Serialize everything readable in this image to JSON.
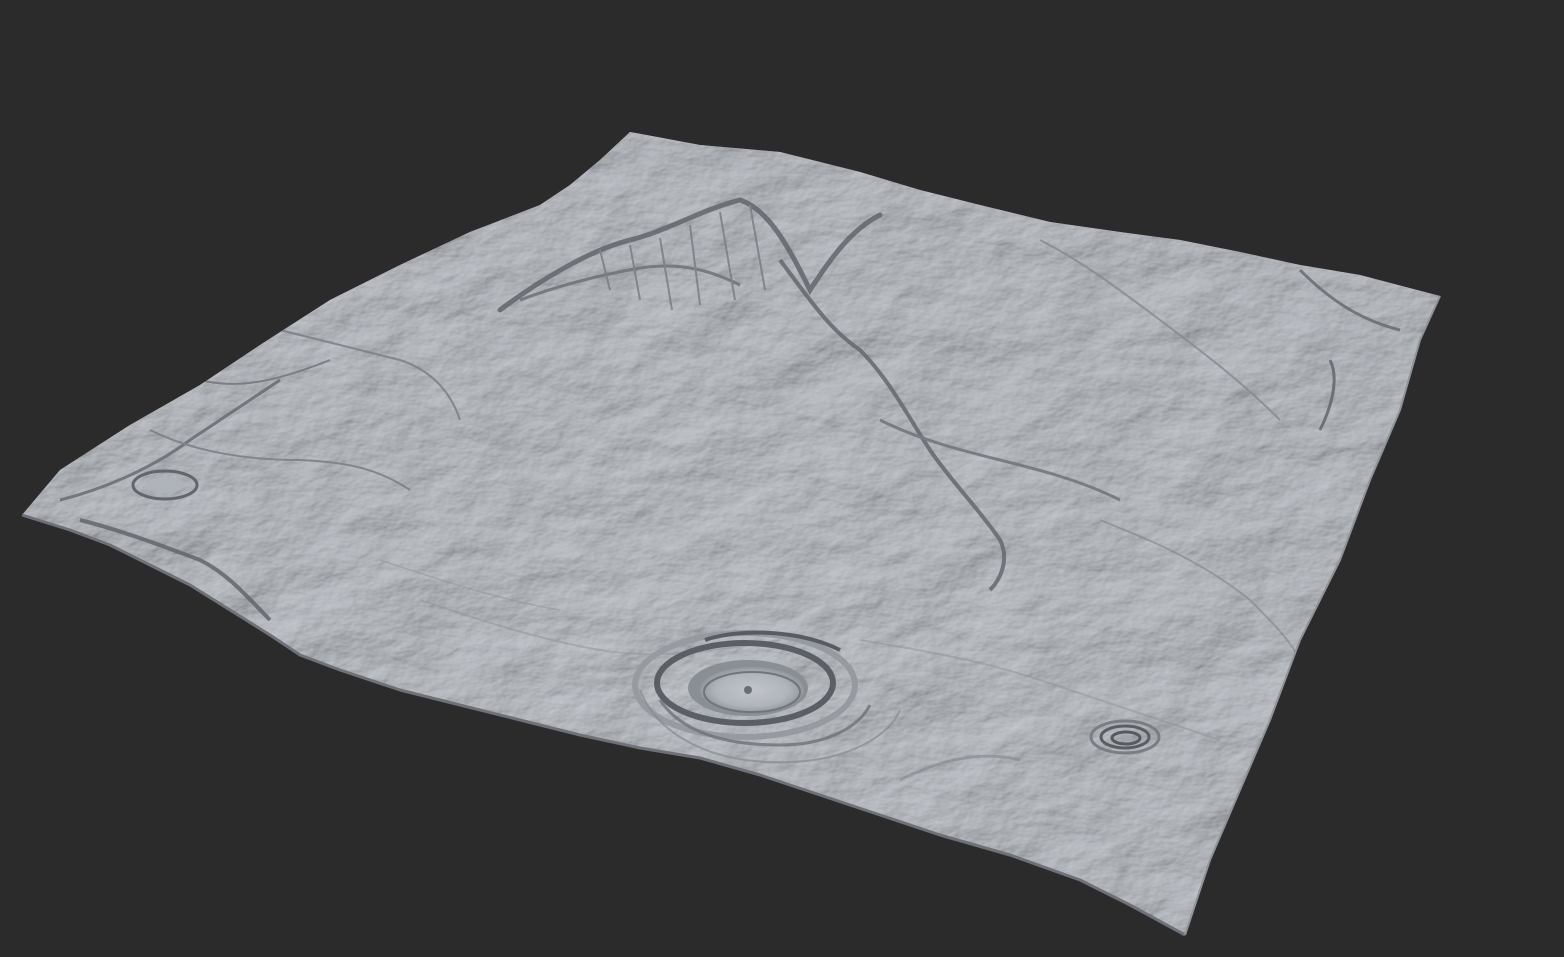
{
  "scene": {
    "background_color": "#2b2b2b",
    "terrain_color": "#b7bcc2",
    "terrain_shadow_color": "#3a3d42",
    "terrain_highlight_color": "#d6dadf",
    "features": [
      "mountain-ridge",
      "large-impact-crater",
      "small-impact-crater",
      "small-crater-left"
    ]
  }
}
